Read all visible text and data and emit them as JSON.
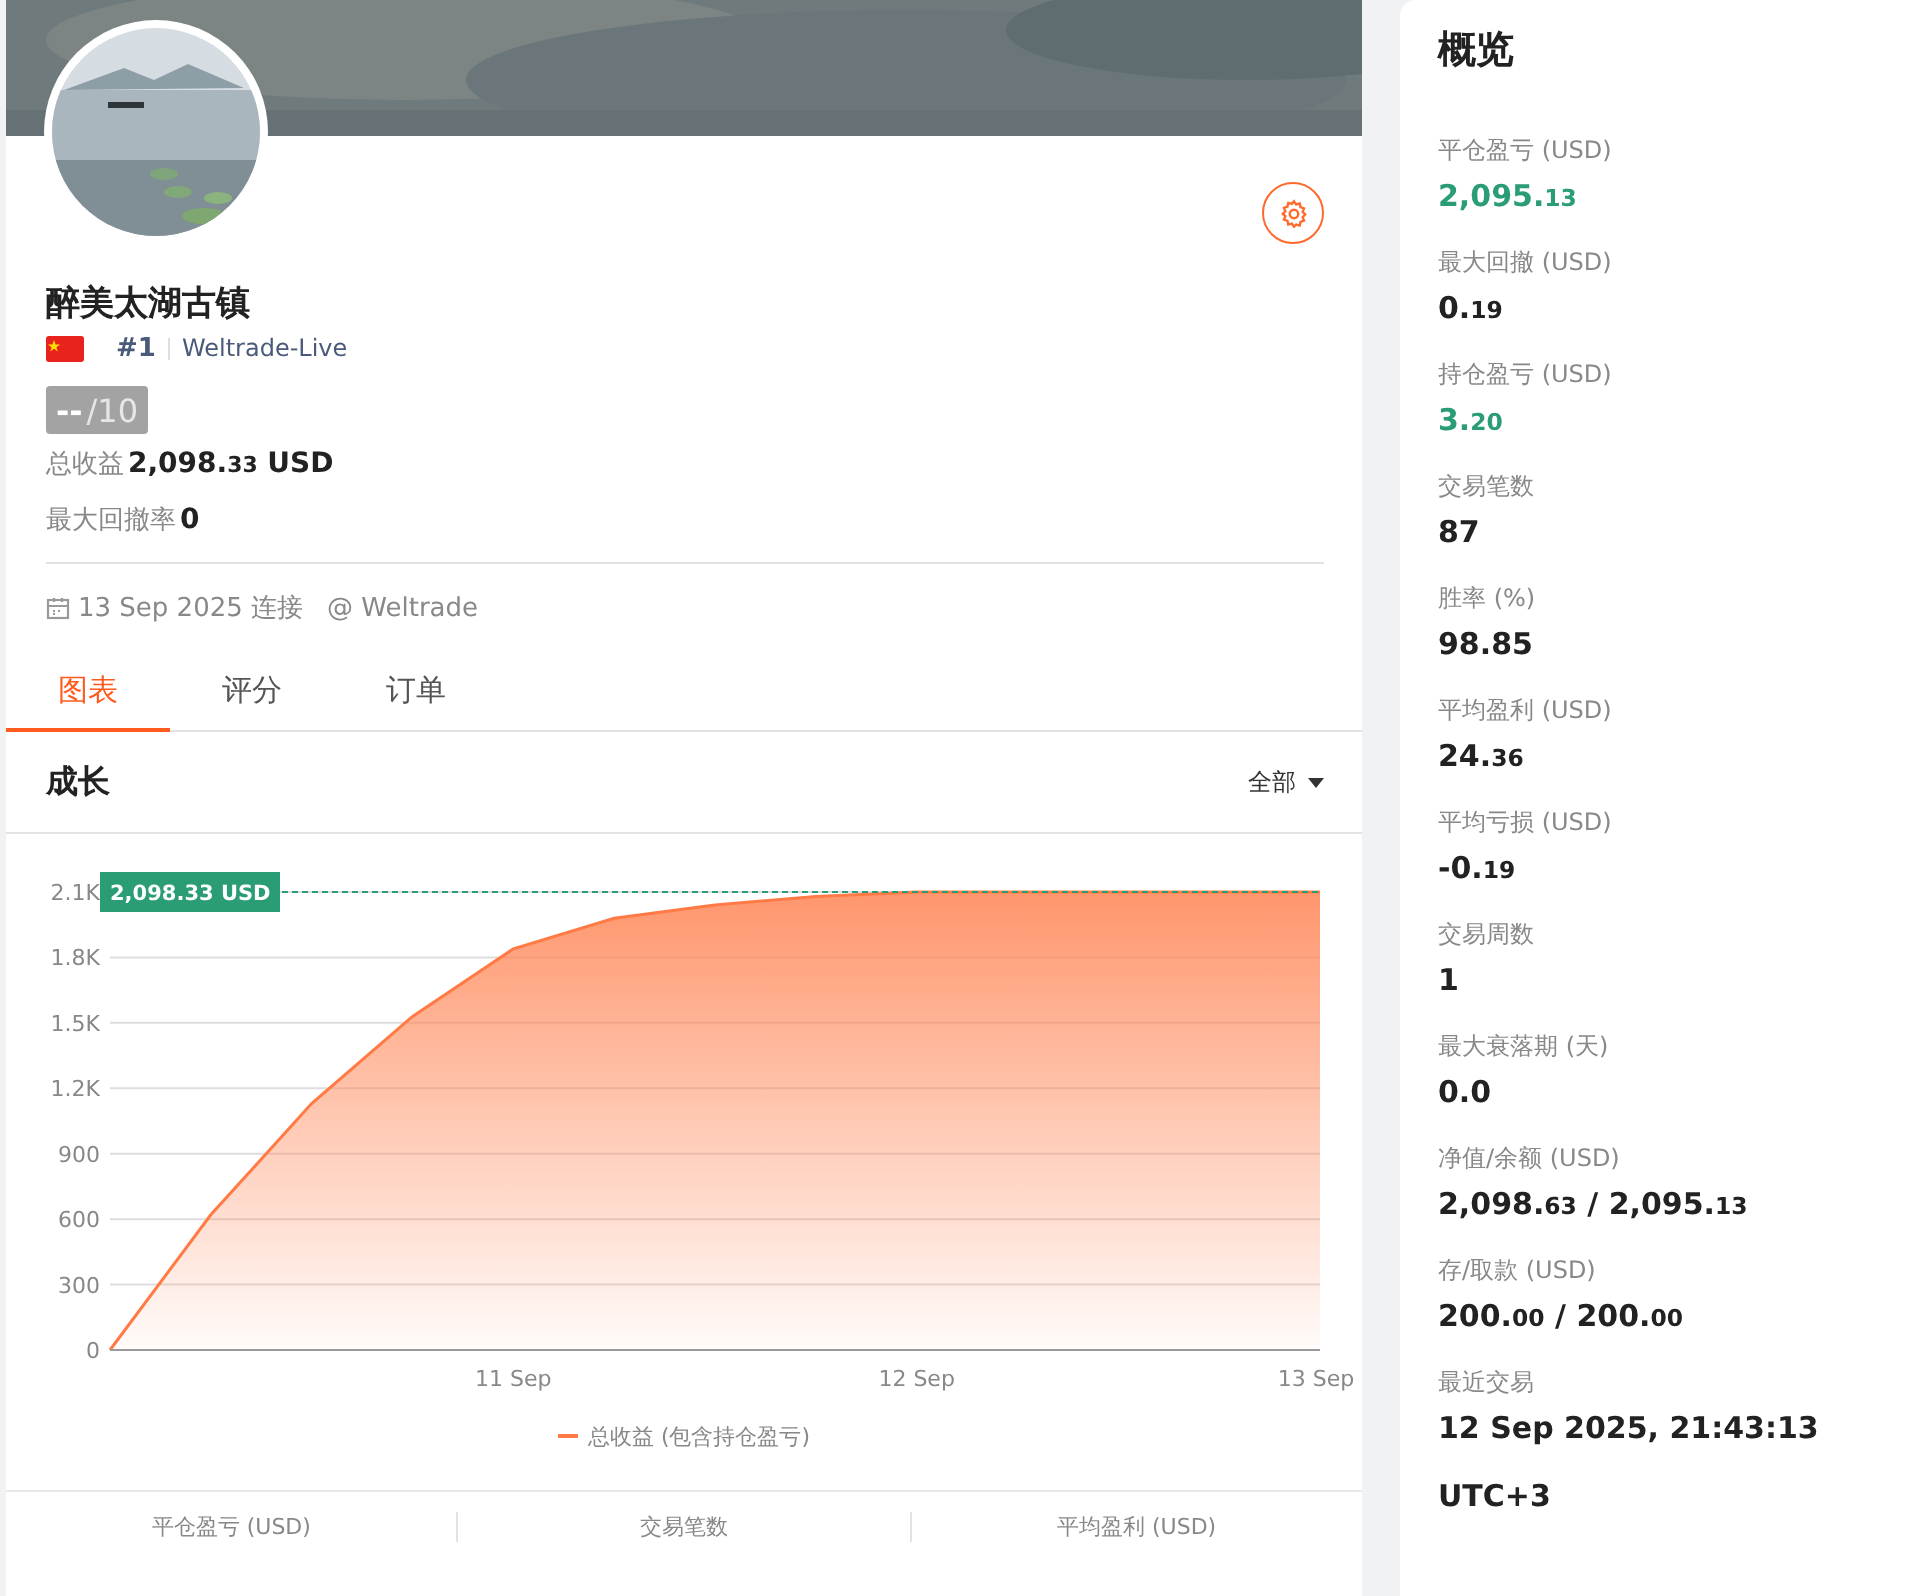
{
  "profile": {
    "name": "醉美太湖古镇",
    "rank": "#1",
    "server": "Weltrade-Live",
    "score": {
      "value": "--",
      "max": "/10"
    },
    "stats": [
      {
        "label": "总收益",
        "parts": [
          {
            "text": "2,098.",
            "small": false
          },
          {
            "text": "33",
            "small": true
          },
          {
            "text": " USD",
            "small": false
          }
        ]
      },
      {
        "label": "最大回撤率",
        "parts": [
          {
            "text": "0",
            "small": false
          }
        ]
      }
    ],
    "connected": "13 Sep 2025 连接",
    "broker": "@ Weltrade"
  },
  "tabs": [
    {
      "label": "图表",
      "selected": true
    },
    {
      "label": "评分",
      "selected": false
    },
    {
      "label": "订单",
      "selected": false
    }
  ],
  "growth": {
    "title": "成长",
    "filter": "全部",
    "chart_data": {
      "type": "area",
      "categories": [
        null,
        null,
        null,
        null,
        "11 Sep",
        null,
        null,
        null,
        "12 Sep",
        null,
        null,
        null,
        "13 Sep"
      ],
      "series": [
        {
          "name": "总收益 (包含持仓盈亏)",
          "color": "#ff7a45",
          "values": [
            0,
            620,
            1130,
            1530,
            1840,
            1980,
            2040,
            2080,
            2100,
            2100,
            2100,
            2100,
            2100
          ]
        }
      ],
      "ylim": [
        0,
        2100
      ],
      "yticks": [
        {
          "value": 0,
          "label": "0"
        },
        {
          "value": 300,
          "label": "300"
        },
        {
          "value": 600,
          "label": "600"
        },
        {
          "value": 900,
          "label": "900"
        },
        {
          "value": 1200,
          "label": "1.2K"
        },
        {
          "value": 1500,
          "label": "1.5K"
        },
        {
          "value": 1800,
          "label": "1.8K"
        },
        {
          "value": 2100,
          "label": "2.1K"
        }
      ],
      "grid": true,
      "annotations": [
        "2,098.33 USD"
      ]
    }
  },
  "bottom_stats": [
    "平仓盈亏 (USD)",
    "交易笔数",
    "平均盈利 (USD)"
  ],
  "overview": {
    "title": "概览",
    "items": [
      {
        "label": "平仓盈亏 (USD)",
        "positive": true,
        "parts": [
          {
            "text": "2,095.",
            "small": false
          },
          {
            "text": "13",
            "small": true
          }
        ]
      },
      {
        "label": "最大回撤 (USD)",
        "positive": false,
        "parts": [
          {
            "text": "0.",
            "small": false
          },
          {
            "text": "19",
            "small": true
          }
        ]
      },
      {
        "label": "持仓盈亏 (USD)",
        "positive": true,
        "parts": [
          {
            "text": "3.",
            "small": false
          },
          {
            "text": "20",
            "small": true
          }
        ]
      },
      {
        "label": "交易笔数",
        "positive": false,
        "parts": [
          {
            "text": "87",
            "small": false
          }
        ]
      },
      {
        "label": "胜率 (%)",
        "positive": false,
        "parts": [
          {
            "text": "98.85",
            "small": false
          }
        ]
      },
      {
        "label": "平均盈利 (USD)",
        "positive": false,
        "parts": [
          {
            "text": "24.",
            "small": false
          },
          {
            "text": "36",
            "small": true
          }
        ]
      },
      {
        "label": "平均亏损 (USD)",
        "positive": false,
        "parts": [
          {
            "text": "-0.",
            "small": false
          },
          {
            "text": "19",
            "small": true
          }
        ]
      },
      {
        "label": "交易周数",
        "positive": false,
        "parts": [
          {
            "text": "1",
            "small": false
          }
        ]
      },
      {
        "label": "最大衰落期 (天)",
        "positive": false,
        "parts": [
          {
            "text": "0.0",
            "small": false
          }
        ]
      },
      {
        "label": "净值/余额 (USD)",
        "positive": false,
        "parts": [
          {
            "text": "2,098.",
            "small": false
          },
          {
            "text": "63",
            "small": true
          },
          {
            "text": " / 2,095.",
            "small": false
          },
          {
            "text": "13",
            "small": true
          }
        ]
      },
      {
        "label": "存/取款 (USD)",
        "positive": false,
        "parts": [
          {
            "text": "200.",
            "small": false
          },
          {
            "text": "00",
            "small": true
          },
          {
            "text": " / 200.",
            "small": false
          },
          {
            "text": "00",
            "small": true
          }
        ]
      },
      {
        "label": "最近交易",
        "positive": false,
        "parts": [
          {
            "text": "12 Sep 2025, 21:43:13",
            "small": false
          }
        ]
      },
      {
        "parts": [
          {
            "text": "UTC+3",
            "small": false
          }
        ],
        "positive": false
      }
    ]
  }
}
